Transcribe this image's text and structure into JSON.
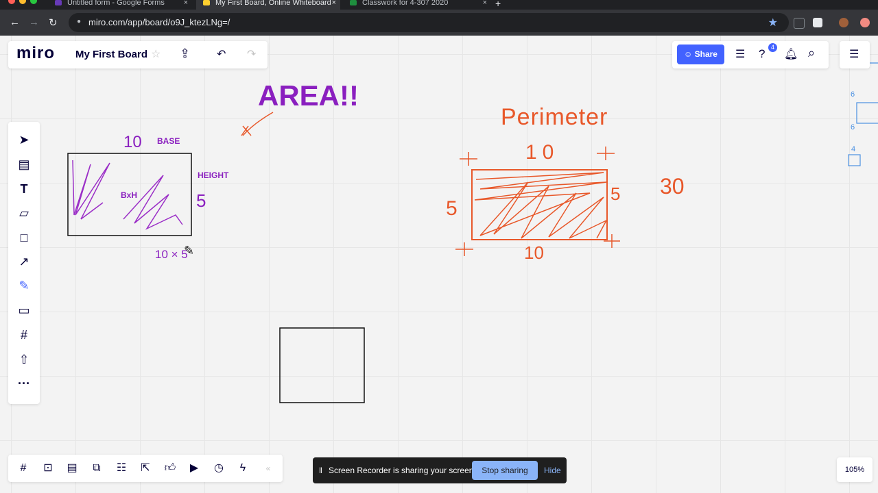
{
  "browser": {
    "tabs": [
      {
        "title": "Untitled form - Google Forms",
        "active": false,
        "color": "#673ab7"
      },
      {
        "title": "My First Board, Online Whiteboard",
        "active": true,
        "color": "#ffd02f"
      },
      {
        "title": "Classwork for 4-307 2020",
        "active": false,
        "color": "#1e8e3e"
      }
    ],
    "new_tab": "+",
    "url": "miro.com/app/board/o9J_ktezLNg=/"
  },
  "miro": {
    "logo": "miro",
    "board_title": "My First Board",
    "share_label": "Share",
    "help_badge": "4",
    "zoom": "105%"
  },
  "board": {
    "area_title": "AREA!!",
    "base_label": "BASE",
    "height_label": "HEIGHT",
    "formula_label": "BxH",
    "area_base_value": "10",
    "area_height_value": "5",
    "area_calc": "10 × 5",
    "perimeter_title": "Perimeter",
    "perim_top": "10",
    "perim_bottom": "10",
    "perim_left": "5",
    "perim_right": "5",
    "perim_total": "30",
    "right_edge_labels": [
      "6",
      "6",
      "4"
    ]
  },
  "notification": {
    "message": "Screen Recorder is sharing your screen.",
    "stop_label": "Stop sharing",
    "hide_label": "Hide"
  },
  "colors": {
    "accent": "#4262ff",
    "purple_ink": "#8a1fbf",
    "orange_ink": "#e8582a"
  }
}
